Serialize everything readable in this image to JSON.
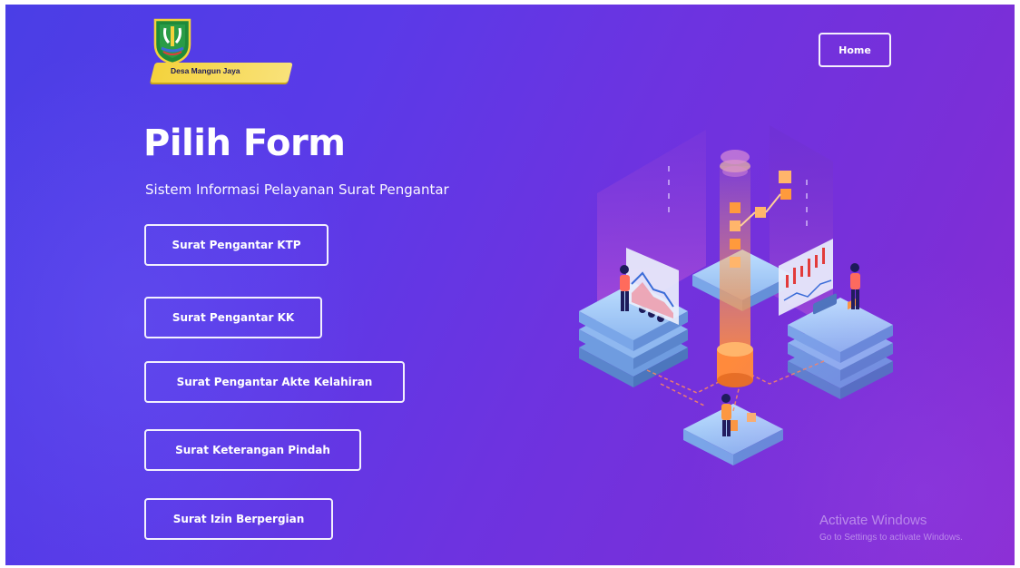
{
  "logo": {
    "text": "Desa Mangun Jaya",
    "icon": "regency-emblem"
  },
  "nav": {
    "home_label": "Home"
  },
  "hero": {
    "title": "Pilih Form",
    "subtitle": "Sistem Informasi Pelayanan Surat Pengantar"
  },
  "forms": [
    {
      "label": "Surat Pengantar KTP"
    },
    {
      "label": "Surat Pengantar KK"
    },
    {
      "label": "Surat Pengantar Akte Kelahiran"
    },
    {
      "label": "Surat Keterangan Pindah"
    },
    {
      "label": "Surat Izin Berpergian"
    }
  ],
  "watermark": {
    "line1": "Activate Windows",
    "line2": "Go to Settings to activate Windows."
  },
  "colors": {
    "bg_start": "#4a3ee6",
    "bg_end": "#8a2bd2",
    "accent_orange": "#ff9a3c",
    "platform_blue": "#7fb2ee",
    "logo_gold": "#f4d23c"
  }
}
